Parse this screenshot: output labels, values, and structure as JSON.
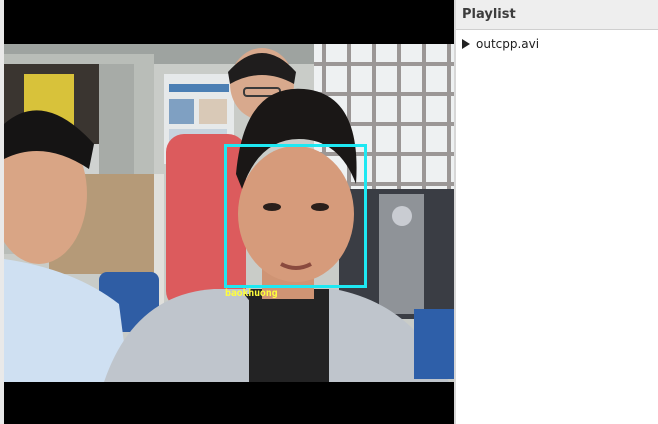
{
  "video": {
    "detection_label": "baokhuong",
    "detection_color": "#1ee8f2",
    "label_color": "#ffff3c"
  },
  "playlist": {
    "title": "Playlist",
    "items": [
      {
        "label": "outcpp.avi",
        "icon": "play-icon"
      }
    ]
  }
}
